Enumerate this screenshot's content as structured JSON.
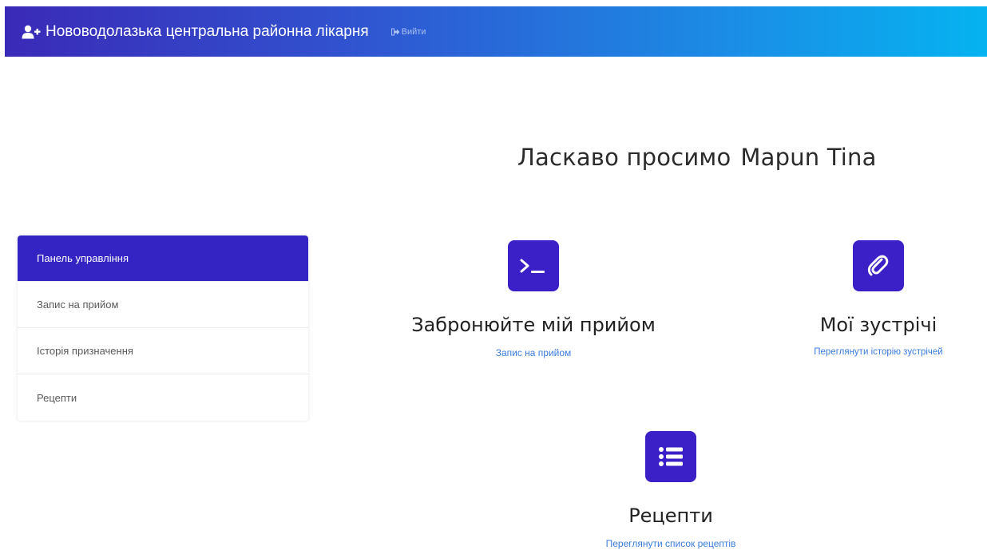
{
  "navbar": {
    "brand_icon": "user-plus-icon",
    "brand_title": "Нововодолазька центральна районна лікарня",
    "logout_icon": "sign-out-icon",
    "logout_label": "Вийти",
    "gradient_start": "#3a2ab8",
    "gradient_end": "#05b3f0"
  },
  "welcome": {
    "greeting": "Ласкаво просимо",
    "user_name": "Марun Tina"
  },
  "sidebar": {
    "active_color": "#3424c4",
    "items": [
      {
        "label": "Панель управління",
        "active": true
      },
      {
        "label": "Запис на прийом",
        "active": false
      },
      {
        "label": "Історія призначення",
        "active": false
      },
      {
        "label": "Рецепти",
        "active": false
      }
    ]
  },
  "features": [
    {
      "icon": "terminal-icon",
      "title": "Забронюйте мій прийом",
      "link": "Запис на прийом"
    },
    {
      "icon": "paperclip-icon",
      "title": "Мої зустрічі",
      "link": "Переглянути історію зустрічей"
    },
    {
      "icon": "list-icon",
      "title": "Рецепти",
      "link": "Переглянути список рецептів"
    }
  ],
  "colors": {
    "icon_bg": "#3a20c6",
    "link": "#3b7ddd"
  }
}
